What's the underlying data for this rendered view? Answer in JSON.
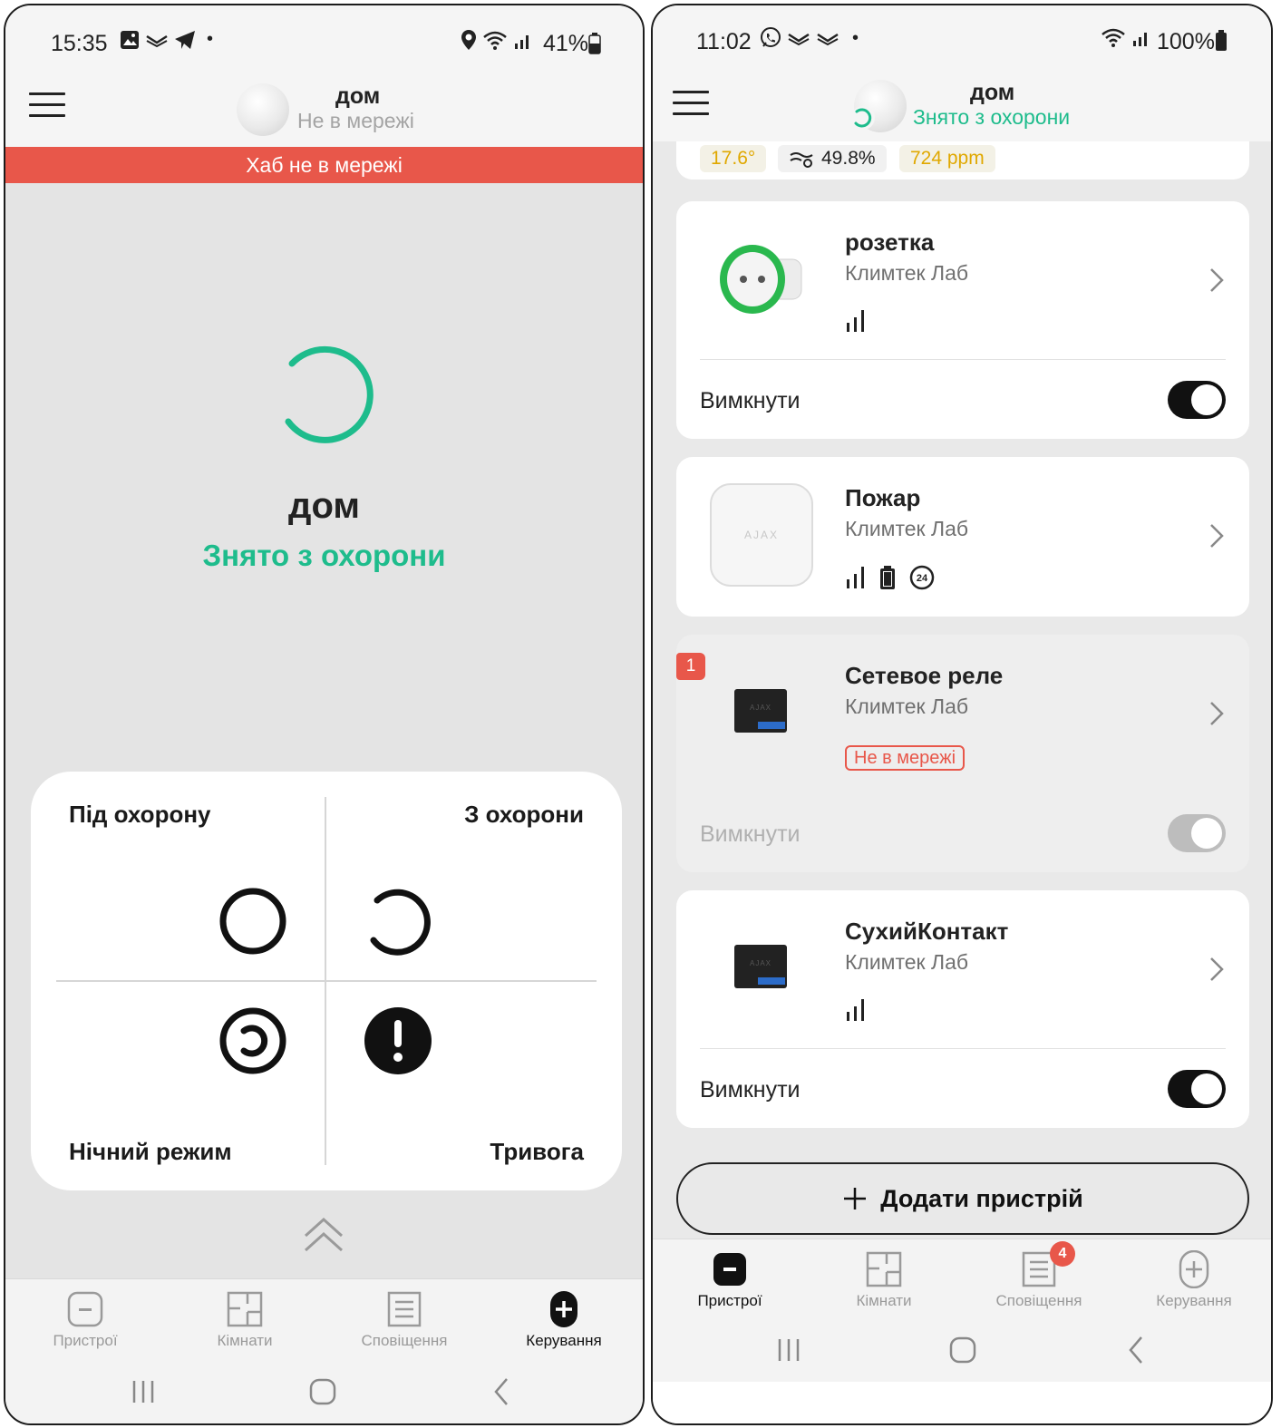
{
  "left": {
    "status_bar": {
      "time": "15:35",
      "battery": "41%"
    },
    "header": {
      "hub_name": "дом",
      "hub_status": "Не в мережі"
    },
    "banner": "Хаб не в мережі",
    "main": {
      "hub_name": "дом",
      "state": "Знято з охорони"
    },
    "control": {
      "arm_label": "Під охорону",
      "disarm_label": "З охорони",
      "night_label": "Нічний режим",
      "panic_label": "Тривога"
    },
    "nav": [
      {
        "label": "Пристрої",
        "icon": "devices-icon"
      },
      {
        "label": "Кімнати",
        "icon": "rooms-icon"
      },
      {
        "label": "Сповіщення",
        "icon": "notifications-icon"
      },
      {
        "label": "Керування",
        "icon": "control-icon"
      }
    ],
    "active_nav": "Керування"
  },
  "right": {
    "status_bar": {
      "time": "11:02",
      "battery": "100%"
    },
    "header": {
      "hub_name": "дом",
      "hub_status": "Знято з охорони"
    },
    "sensor_chips": {
      "temperature": "17.6°",
      "humidity": "49.8%",
      "co2": "724 ppm"
    },
    "devices": [
      {
        "name": "розетка",
        "room": "Климтек Лаб",
        "toggle_label": "Вимкнути",
        "icons": [
          "signal-icon"
        ]
      },
      {
        "name": "Пожар",
        "room": "Климтек Лаб",
        "icons": [
          "signal-icon",
          "battery-icon",
          "24h-icon"
        ],
        "image_text": "AJAX"
      },
      {
        "name": "Сетевое реле",
        "room": "Климтек Лаб",
        "badge": "1",
        "offline_tag": "Не в мережі",
        "toggle_label": "Вимкнути"
      },
      {
        "name": "СухийКонтакт",
        "room": "Климтек Лаб",
        "toggle_label": "Вимкнути",
        "icons": [
          "signal-icon"
        ]
      }
    ],
    "add_device": "Додати пристрій",
    "nav": [
      {
        "label": "Пристрої",
        "icon": "devices-icon"
      },
      {
        "label": "Кімнати",
        "icon": "rooms-icon"
      },
      {
        "label": "Сповіщення",
        "icon": "notifications-icon",
        "badge": "4"
      },
      {
        "label": "Керування",
        "icon": "control-icon"
      }
    ],
    "active_nav": "Пристрої"
  },
  "colors": {
    "accent_green": "#1ebc8c",
    "alert_red": "#e8574a",
    "chip_yellow": "#e0a800"
  }
}
